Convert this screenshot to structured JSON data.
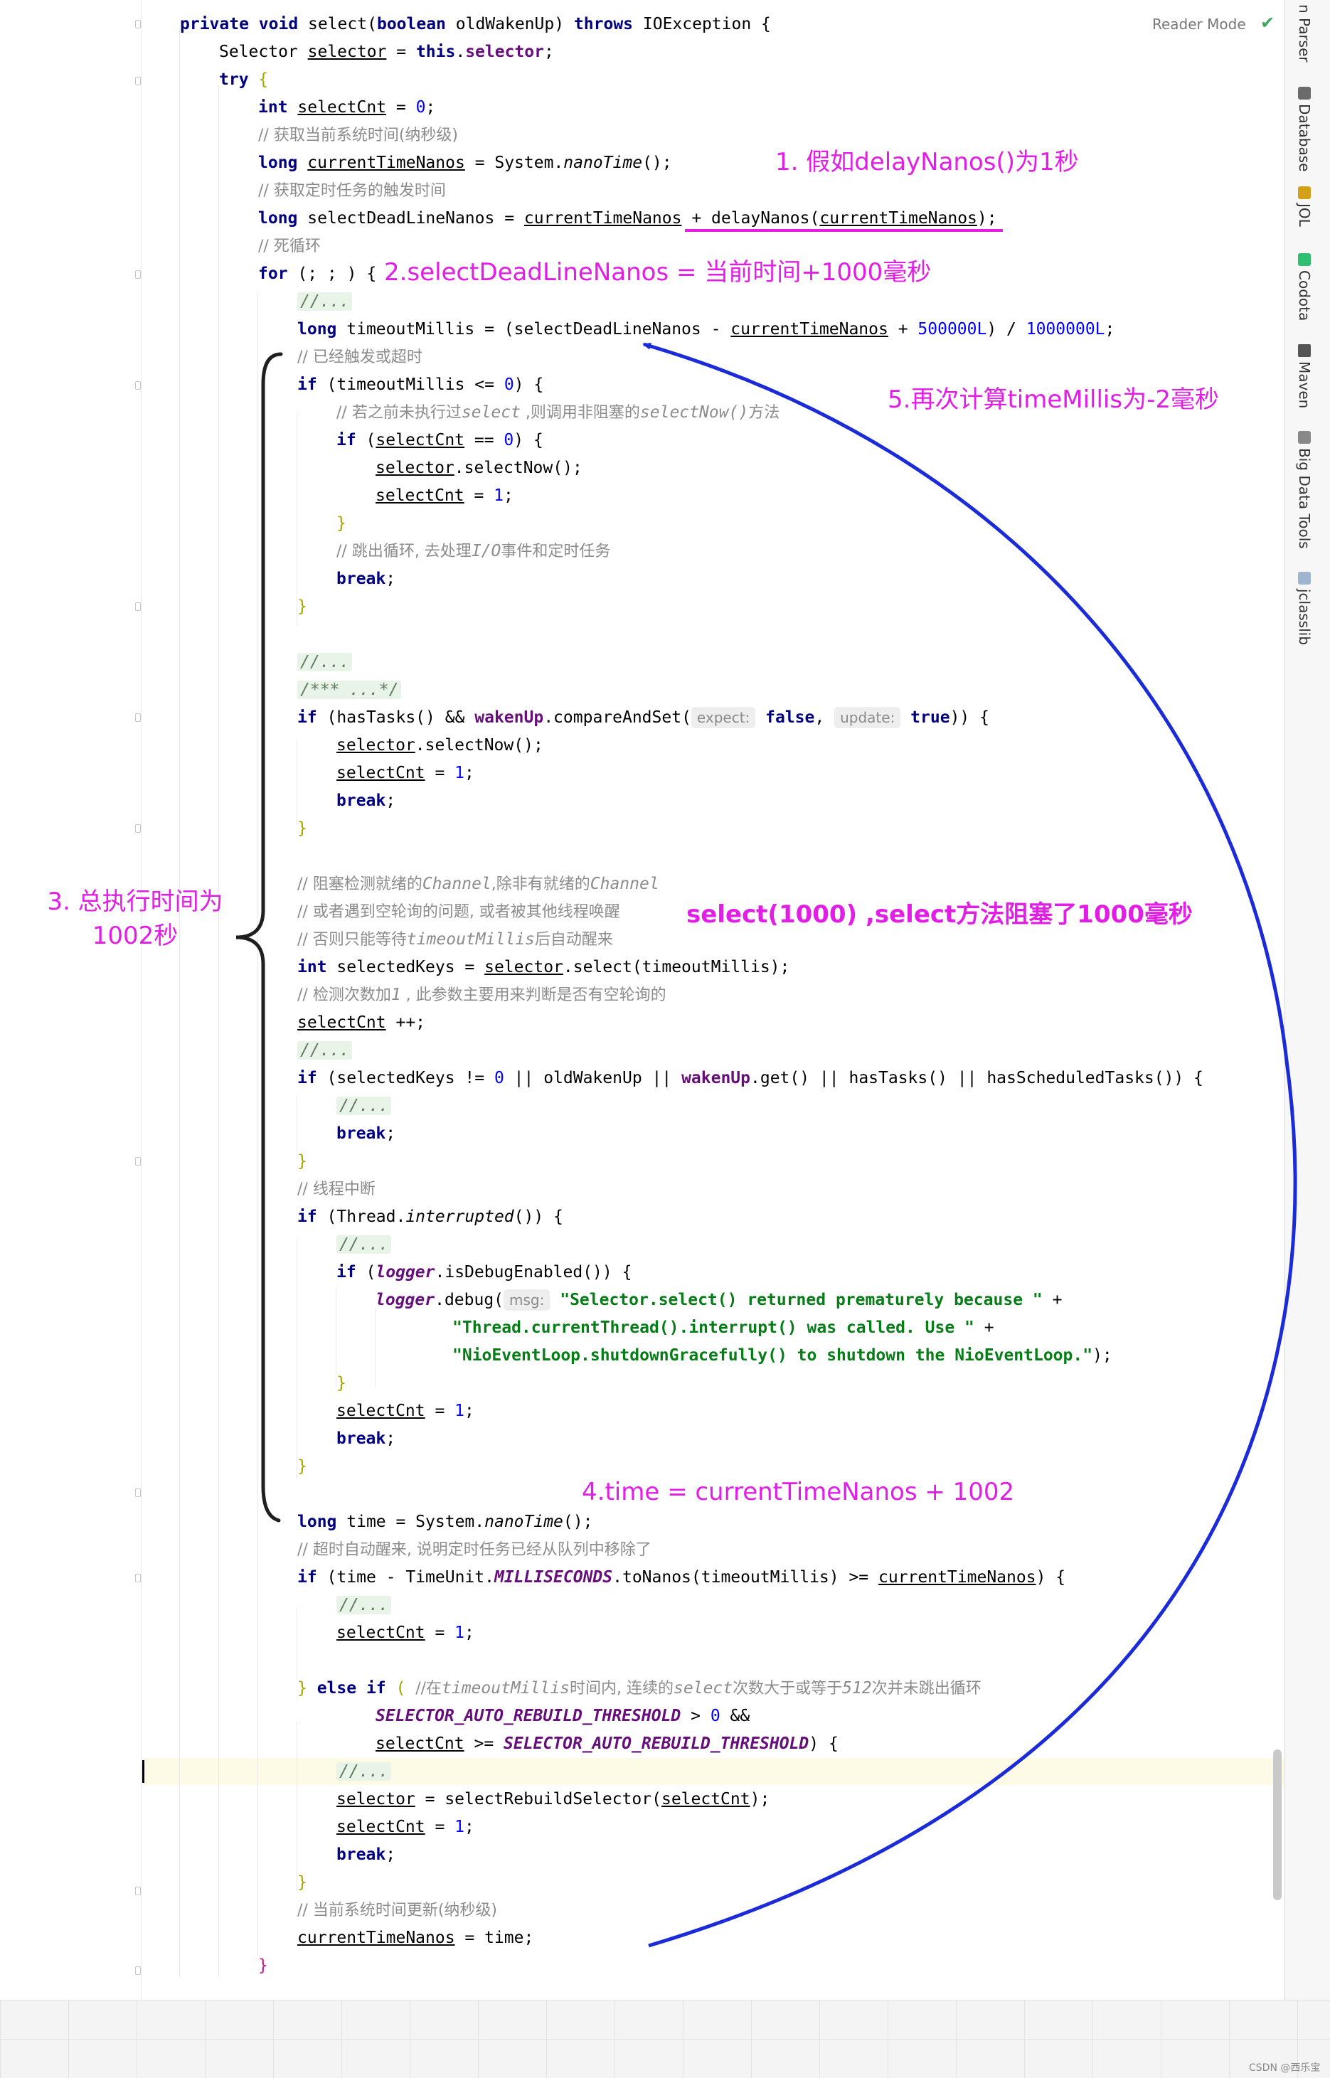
{
  "editor": {
    "reader_mode": "Reader Mode",
    "check_icon": "checkmark-icon",
    "watermark": "CSDN @西乐宝",
    "lines": {
      "l1": [
        "private void ",
        "select",
        "(",
        "boolean ",
        "oldWakenUp",
        ") ",
        "throws ",
        "IOException {"
      ],
      "l2": [
        "Selector ",
        "selector",
        " = ",
        "this",
        ".",
        "selector",
        ";"
      ],
      "l3": [
        "try",
        " {"
      ],
      "l4": [
        "int ",
        "selectCnt",
        " = ",
        "0",
        ";"
      ],
      "l5": [
        "// 获取当前系统时间(纳秒级)"
      ],
      "l6": [
        "long ",
        "currentTimeNanos",
        " = System.",
        "nanoTime",
        "();"
      ],
      "l7": [
        "// 获取定时任务的触发时间"
      ],
      "l8": [
        "long ",
        "selectDeadLineNanos",
        " = ",
        "currentTimeNanos",
        " + delayNanos(",
        "currentTimeNanos",
        ");"
      ],
      "l9": [
        "// 死循环"
      ],
      "l10": [
        "for",
        " (; ; ) {"
      ],
      "l11": [
        "//..."
      ],
      "l12": [
        "long ",
        "timeoutMillis",
        " = (selectDeadLineNanos - ",
        "currentTimeNanos",
        " + ",
        "500000L",
        ") / ",
        "1000000L",
        ";"
      ],
      "l13": [
        "// 已经触发或超时"
      ],
      "l14": [
        "if",
        " (timeoutMillis <= ",
        "0",
        ") {"
      ],
      "l15": [
        "// 若之前未执行过",
        "select",
        " ,则调用非阻塞的",
        "selectNow()",
        "方法"
      ],
      "l16": [
        "if",
        " (",
        "selectCnt",
        " == ",
        "0",
        ") {"
      ],
      "l17": [
        "selector",
        ".selectNow",
        "();"
      ],
      "l18": [
        "selectCnt",
        " = ",
        "1",
        ";"
      ],
      "l19": [
        "}"
      ],
      "l20": [
        "// 跳出循环, 去处理",
        "I/O",
        "事件和定时任务"
      ],
      "l21": [
        "break",
        ";"
      ],
      "l22": [
        "}"
      ],
      "l23": [
        "//..."
      ],
      "l24": [
        "/*** ...*/"
      ],
      "l25": [
        "if",
        " (hasTasks() && ",
        "wakenUp",
        ".compareAndSet(",
        "expect:",
        " false",
        ", ",
        "update:",
        " true",
        ")) {"
      ],
      "l26": [
        "selector",
        ".selectNow();"
      ],
      "l27": [
        "selectCnt",
        " = ",
        "1",
        ";"
      ],
      "l28": [
        "break",
        ";"
      ],
      "l29": [
        "}"
      ],
      "l30": [
        "// 阻塞检测就绪的",
        "Channel",
        ",除非有就绪的",
        "Channel"
      ],
      "l31": [
        "// 或者遇到空轮询的问题, 或者被其他线程唤醒"
      ],
      "l32": [
        "// 否则只能等待",
        "timeoutMillis",
        "后自动醒来"
      ],
      "l33": [
        "int ",
        "selectedKeys",
        " = ",
        "selector",
        ".select(timeoutMillis);"
      ],
      "l34": [
        "// 检测次数加",
        "1",
        " , 此参数主要用来判断是否有空轮询的"
      ],
      "l35": [
        "selectCnt",
        " ++;"
      ],
      "l36": [
        "//..."
      ],
      "l37": [
        "if",
        " (selectedKeys != ",
        "0",
        " || oldWakenUp || ",
        "wakenUp",
        ".get() || hasTasks() || hasScheduledTasks()) {"
      ],
      "l38": [
        "//..."
      ],
      "l39": [
        "break",
        ";"
      ],
      "l40": [
        "}"
      ],
      "l41": [
        "// 线程中断"
      ],
      "l42": [
        "if",
        " (Thread.",
        "interrupted",
        "()) {"
      ],
      "l43": [
        "//..."
      ],
      "l44": [
        "if",
        " (",
        "logger",
        ".isDebugEnabled()) {"
      ],
      "l45": [
        "logger",
        ".debug(",
        "msg:",
        " \"Selector.select() returned prematurely because \"",
        " +"
      ],
      "l46": [
        "\"Thread.currentThread().interrupt() was called. Use \"",
        " +"
      ],
      "l47": [
        "\"NioEventLoop.shutdownGracefully() to shutdown the NioEventLoop.\"",
        ");"
      ],
      "l48": [
        "}"
      ],
      "l49": [
        "selectCnt",
        " = ",
        "1",
        ";"
      ],
      "l50": [
        "break",
        ";"
      ],
      "l51": [
        "}"
      ],
      "l52": [
        "long ",
        "time = System.",
        "nanoTime",
        "();"
      ],
      "l53": [
        "// 超时自动醒来, 说明定时任务已经从队列中移除了"
      ],
      "l54": [
        "if",
        " (time - TimeUnit.",
        "MILLISECONDS",
        ".toNanos(timeoutMillis) >= ",
        "currentTimeNanos",
        ") {"
      ],
      "l55": [
        "//..."
      ],
      "l56": [
        "selectCnt",
        " = ",
        "1",
        ";"
      ],
      "l57": [
        "} ",
        "else if",
        " ( ",
        "//在",
        "timeoutMillis",
        "时间内, 连续的",
        "select",
        "次数大于或等于",
        "512",
        "次并未跳出循环"
      ],
      "l58": [
        "SELECTOR_AUTO_REBUILD_THRESHOLD",
        " > ",
        "0",
        " &&"
      ],
      "l59": [
        "selectCnt",
        " >= ",
        "SELECTOR_AUTO_REBUILD_THRESHOLD",
        ") {"
      ],
      "l60": [
        "//..."
      ],
      "l61": [
        "selector",
        " = selectRebuildSelector(",
        "selectCnt",
        ");"
      ],
      "l62": [
        "selectCnt",
        " = ",
        "1",
        ";"
      ],
      "l63": [
        "break",
        ";"
      ],
      "l64": [
        "}"
      ],
      "l65": [
        "// 当前系统时间更新(纳秒级)"
      ],
      "l66": [
        "currentTimeNanos",
        " = time;"
      ],
      "l67": [
        "}"
      ]
    }
  },
  "toolstrip": [
    {
      "label": "n Parser",
      "icon": "parser-icon"
    },
    {
      "label": "Database",
      "icon": "database-icon"
    },
    {
      "label": "JOL",
      "icon": "jol-icon"
    },
    {
      "label": "Codota",
      "icon": "codota-icon"
    },
    {
      "label": "Maven",
      "icon": "maven-icon"
    },
    {
      "label": "Big Data Tools",
      "icon": "bigdata-icon"
    },
    {
      "label": "jclasslib",
      "icon": "jclasslib-icon"
    }
  ],
  "annotations": {
    "a1": "1. 假如delayNanos()为1秒",
    "a2": "2.selectDeadLineNanos = 当前时间+1000毫秒",
    "a3": "3. 总执行时间为\n1002秒",
    "a_select": "select(1000) ,select方法阻塞了1000毫秒",
    "a4": "4.time = currentTimeNanos + 1002",
    "a5": "5.再次计算timeMillis为-2毫秒",
    "colors": {
      "magenta": "#e21de6",
      "blue": "#1b2bd8"
    }
  }
}
